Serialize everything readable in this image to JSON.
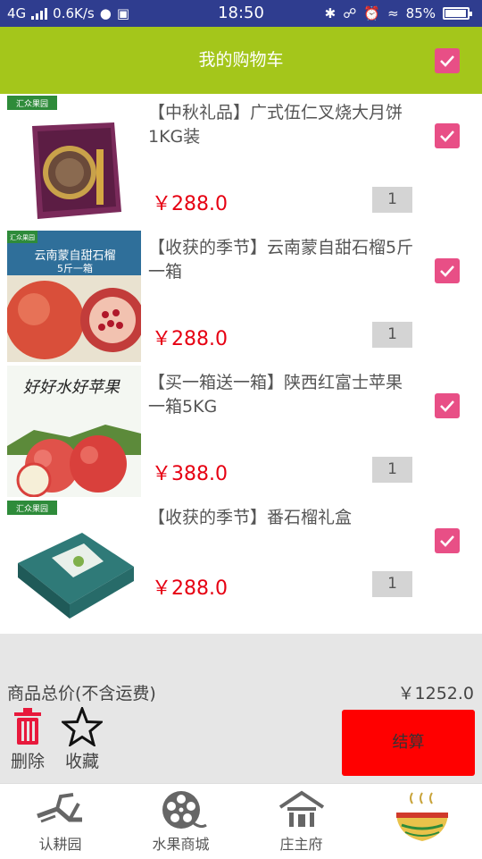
{
  "status_bar": {
    "network": "4G",
    "speed": "0.6K/s",
    "time": "18:50",
    "battery": "85%"
  },
  "header": {
    "title": "我的购物车",
    "select_all_checked": true
  },
  "items": [
    {
      "title": "【中秋礼品】广式伍仁叉烧大月饼  1KG装",
      "price": "￥288.0",
      "qty": "1",
      "checked": true
    },
    {
      "title": "【收获的季节】云南蒙自甜石榴5斤一箱",
      "price": "￥288.0",
      "qty": "1",
      "checked": true
    },
    {
      "title": "【买一箱送一箱】陕西红富士苹果 一箱5KG",
      "price": "￥388.0",
      "qty": "1",
      "checked": true
    },
    {
      "title": "【收获的季节】番石榴礼盒",
      "price": "￥288.0",
      "qty": "1",
      "checked": true
    }
  ],
  "thumb_text": {
    "brand": "汇众果园",
    "pomegranate_banner": "云南蒙自甜石榴",
    "pomegranate_sub": "5斤一箱",
    "apple_banner": "好好水好苹果"
  },
  "summary": {
    "total_label": "商品总价(不含运费)",
    "total_value": "￥1252.0",
    "delete_label": "删除",
    "favorite_label": "收藏",
    "checkout_label": "结算"
  },
  "tabs": [
    {
      "label": "认耕园",
      "icon": "plow-icon"
    },
    {
      "label": "水果商城",
      "icon": "film-reel-icon"
    },
    {
      "label": "庄主府",
      "icon": "house-icon"
    },
    {
      "label": "",
      "icon": "logo-bowl-icon"
    }
  ],
  "colors": {
    "header_bg": "#a4c61b",
    "checkbox": "#e84f86",
    "price": "#e60012",
    "checkout_bg": "#ff0000",
    "status_bar": "#2f3d8f"
  }
}
